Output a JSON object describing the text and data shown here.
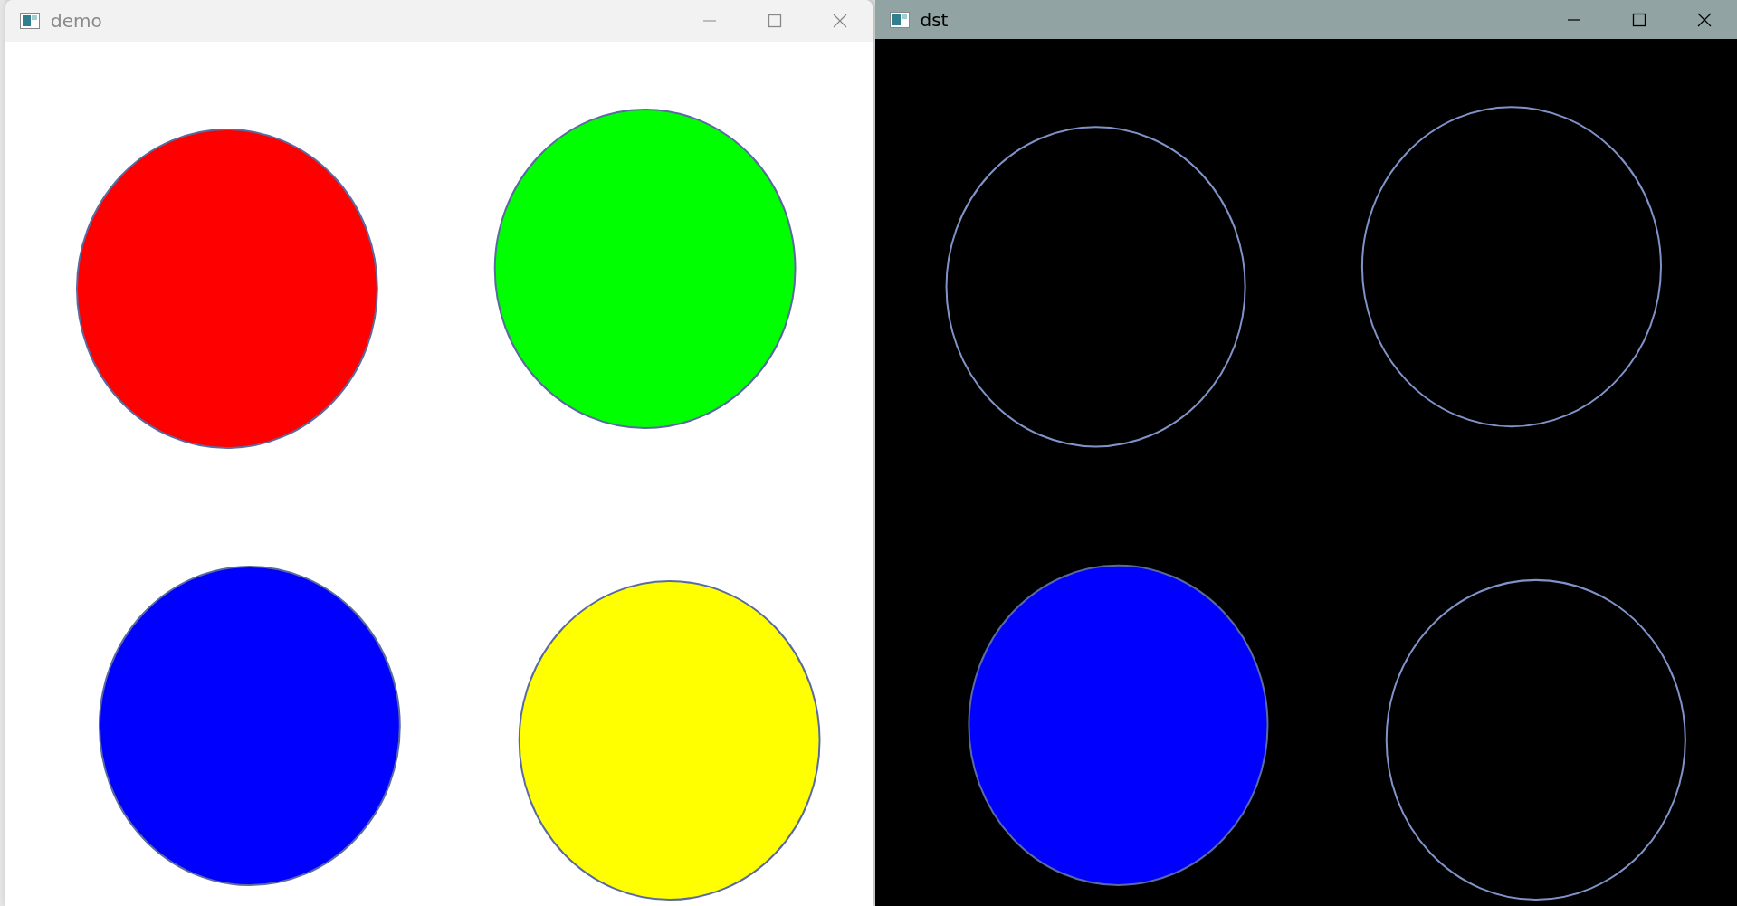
{
  "windows": [
    {
      "title": "demo",
      "active": false,
      "circles": [
        {
          "kind": "filled",
          "color": "#ff0000"
        },
        {
          "kind": "filled",
          "color": "#00ff00"
        },
        {
          "kind": "filled",
          "color": "#0000ff"
        },
        {
          "kind": "filled",
          "color": "#ffff00"
        }
      ]
    },
    {
      "title": "dst",
      "active": true,
      "circles": [
        {
          "kind": "outline",
          "color": "#7f93c8"
        },
        {
          "kind": "outline",
          "color": "#7f93c8"
        },
        {
          "kind": "filled",
          "color": "#0000ff"
        },
        {
          "kind": "outline",
          "color": "#7f93c8"
        }
      ]
    }
  ]
}
